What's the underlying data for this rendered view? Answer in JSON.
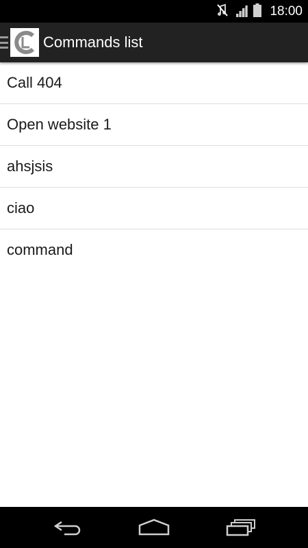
{
  "status_bar": {
    "time": "18:00",
    "icons": [
      "mute-icon",
      "signal-icon",
      "battery-icon"
    ]
  },
  "action_bar": {
    "title": "Commands list",
    "logo_letters": "CL",
    "icons": [
      "drawer-menu-icon",
      "app-logo-icon"
    ]
  },
  "commands": [
    {
      "label": "Call 404"
    },
    {
      "label": "Open website 1"
    },
    {
      "label": "ahsjsis"
    },
    {
      "label": "ciao"
    },
    {
      "label": "command"
    }
  ],
  "nav_bar": {
    "icons": [
      "back-icon",
      "home-icon",
      "recent-apps-icon"
    ]
  },
  "colors": {
    "action_bar_bg": "#222222",
    "divider": "#dedede",
    "text": "#1a1a1a",
    "logo_grey": "#8a8a8a"
  }
}
